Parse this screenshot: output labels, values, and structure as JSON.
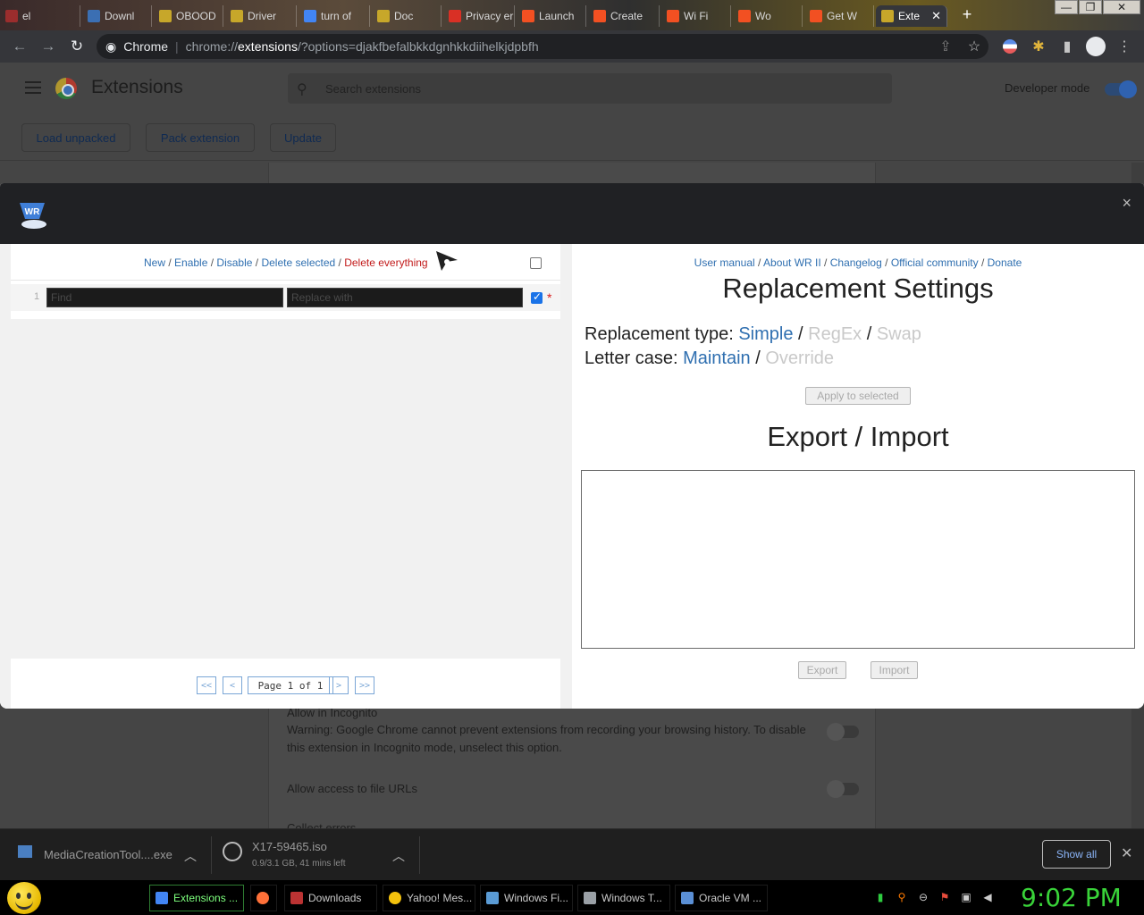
{
  "browser": {
    "tabs": [
      {
        "label": "el",
        "color": "#9b2d2d"
      },
      {
        "label": "Downl",
        "color": "#3b6fb3"
      },
      {
        "label": "OBOOD",
        "color": "#c7a72a"
      },
      {
        "label": "Driver",
        "color": "#c7a72a"
      },
      {
        "label": "turn of",
        "color": "#4285f4"
      },
      {
        "label": "Doc",
        "color": "#c7a72a"
      },
      {
        "label": "Privacy error",
        "color": "#d93025"
      },
      {
        "label": "Launch",
        "color": "#f25022"
      },
      {
        "label": "Create",
        "color": "#f25022"
      },
      {
        "label": "Wi Fi",
        "color": "#f25022"
      },
      {
        "label": "Wo",
        "color": "#f25022"
      },
      {
        "label": "Get W",
        "color": "#f25022"
      },
      {
        "label": "Exte",
        "color": "#c7a72a",
        "active": true
      }
    ],
    "new_tab": "+",
    "url_site": "Chrome",
    "url_prefix": "chrome://",
    "url_host": "extensions",
    "url_path": "/?options=djakfbefalbkkdgnhkkdiihelkjdpbfh",
    "window_controls": [
      "—",
      "❐",
      "✕"
    ]
  },
  "extensions_page": {
    "title": "Extensions",
    "search_placeholder": "Search extensions",
    "developer_mode_label": "Developer mode",
    "developer_mode_on": true,
    "buttons": {
      "load_unpacked": "Load unpacked",
      "pack_extension": "Pack extension",
      "update": "Update"
    },
    "incognito_title": "Allow in Incognito",
    "incognito_warning": "Warning: Google Chrome cannot prevent extensions from recording your browsing history. To disable this extension in Incognito mode, unselect this option.",
    "file_urls": "Allow access to file URLs",
    "collect_errors": "Collect errors"
  },
  "modal": {
    "logo_text": "WR",
    "close": "×",
    "left": {
      "link_new": "New",
      "link_enable": "Enable",
      "link_disable": "Disable",
      "link_delete_selected": "Delete selected",
      "link_delete_everything": "Delete everything",
      "separator": " / ",
      "row_number": "1",
      "find_placeholder": "Find",
      "replace_placeholder": "Replace with",
      "required_mark": "*",
      "row_checked": true,
      "pager": {
        "first": "<<",
        "prev": "<",
        "label": "Page 1 of 1",
        "next": ">",
        "last": ">>"
      }
    },
    "right": {
      "links": {
        "user_manual": "User manual",
        "about": "About WR II",
        "changelog": "Changelog",
        "community": "Official community",
        "donate": "Donate"
      },
      "settings_title": "Replacement Settings",
      "replacement_type_label": "Replacement type:",
      "replacement_types": {
        "simple": "Simple",
        "regex": "RegEx",
        "swap": "Swap"
      },
      "letter_case_label": "Letter case:",
      "letter_cases": {
        "maintain": "Maintain",
        "override": "Override"
      },
      "apply_button": "Apply to selected",
      "export_import_title": "Export / Import",
      "export_button": "Export",
      "import_button": "Import"
    }
  },
  "downloads": {
    "items": [
      {
        "name": "MediaCreationTool....exe",
        "sub": ""
      },
      {
        "name": "X17-59465.iso",
        "sub": "0.9/3.1 GB, 41 mins left"
      }
    ],
    "show_all": "Show all",
    "close": "✕"
  },
  "taskbar": {
    "items": [
      {
        "label": "Extensions ...",
        "color": "#4285f4",
        "active": true
      },
      {
        "label": "",
        "color": "#ff7139"
      },
      {
        "label": "Downloads",
        "color": "#b33"
      },
      {
        "label": "Yahoo! Mes...",
        "color": "#f4c20d"
      },
      {
        "label": "Windows Fi...",
        "color": "#5a9bd5"
      },
      {
        "label": "Windows T...",
        "color": "#9aa0a6"
      },
      {
        "label": "Oracle VM ...",
        "color": "#5a8fd5"
      }
    ],
    "clock": "9:02 PM"
  }
}
